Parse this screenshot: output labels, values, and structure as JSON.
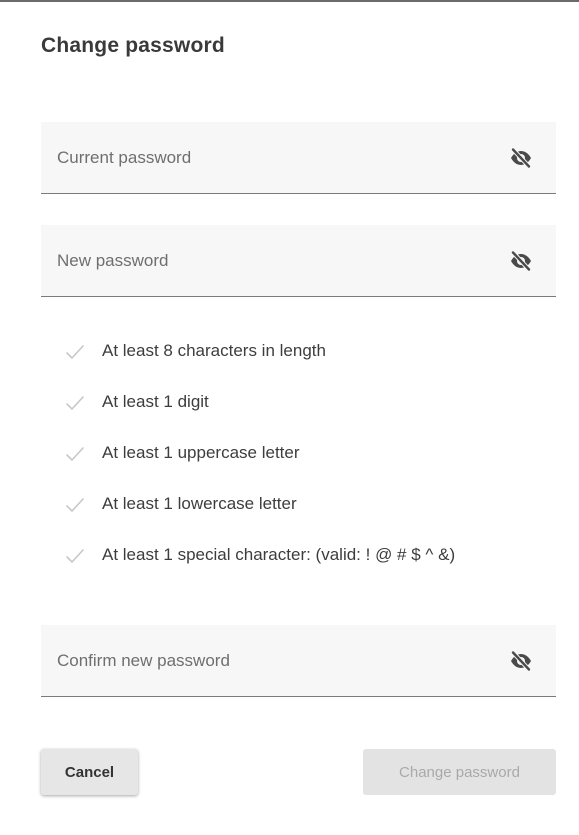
{
  "dialog": {
    "title": "Change password"
  },
  "fields": {
    "current": {
      "placeholder": "Current password",
      "value": "",
      "toggle_icon": "eye-slash-icon"
    },
    "new": {
      "placeholder": "New password",
      "value": "",
      "toggle_icon": "eye-slash-icon"
    },
    "confirm": {
      "placeholder": "Confirm new password",
      "value": "",
      "toggle_icon": "eye-slash-icon"
    }
  },
  "requirements": [
    {
      "label": "At least 8 characters in length",
      "icon": "check-icon"
    },
    {
      "label": "At least 1 digit",
      "icon": "check-icon"
    },
    {
      "label": "At least 1 uppercase letter",
      "icon": "check-icon"
    },
    {
      "label": "At least 1 lowercase letter",
      "icon": "check-icon"
    },
    {
      "label": "At least 1 special character: (valid: ! @ # $ ^ &)",
      "icon": "check-icon"
    }
  ],
  "actions": {
    "cancel_label": "Cancel",
    "submit_label": "Change password",
    "submit_enabled": false
  },
  "colors": {
    "field_background": "#f6f7f6",
    "check_color": "#c8c8c8",
    "icon_color": "#4a4a4a",
    "disabled_text": "#a9a9a9"
  }
}
